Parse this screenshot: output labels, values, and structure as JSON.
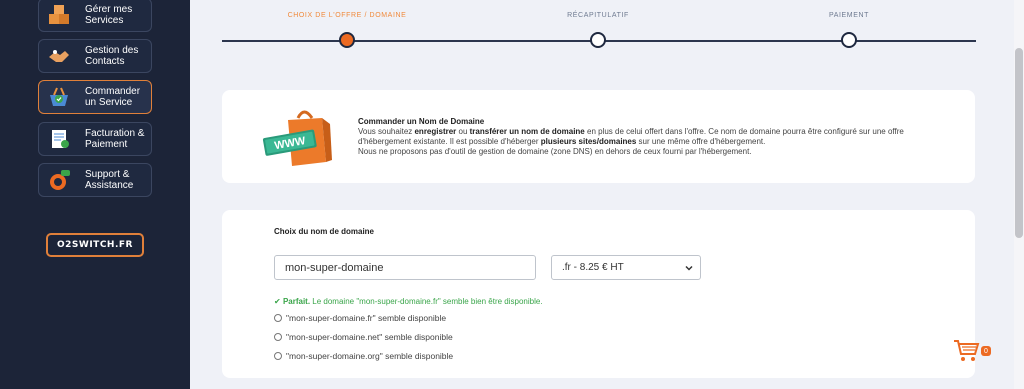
{
  "sidebar": {
    "items": [
      {
        "label": "Gérer mes Services",
        "icon": "boxes-icon",
        "active": false
      },
      {
        "label": "Gestion des Contacts",
        "icon": "handshake-icon",
        "active": false
      },
      {
        "label": "Commander un Service",
        "icon": "shopping-basket-icon",
        "active": true
      },
      {
        "label": "Facturation & Paiement",
        "icon": "invoice-icon",
        "active": false
      },
      {
        "label": "Support & Assistance",
        "icon": "lifebuoy-icon",
        "active": false
      }
    ],
    "domain_button": "O2SWITCH.FR"
  },
  "stepper": {
    "steps": [
      {
        "label": "CHOIX DE L'OFFRE / DOMAINE",
        "active": true
      },
      {
        "label": "RÉCAPITULATIF",
        "active": false
      },
      {
        "label": "PAIEMENT",
        "active": false
      }
    ]
  },
  "info": {
    "illustration_text": "WWW",
    "title": "Commander un Nom de Domaine",
    "p1_a": "Vous souhaitez ",
    "p1_b": "enregistrer",
    "p1_c": " ou ",
    "p1_d": "transférer un nom de domaine",
    "p1_e": " en plus de celui offert dans l'offre. Ce nom de domaine pourra être configuré sur une offre d'hébergement existante. Il est possible d'héberger ",
    "p1_f": "plusieurs sites/domaines",
    "p1_g": " sur une même offre d'hébergement.",
    "p2": "Nous ne proposons pas d'outil de gestion de domaine (zone DNS) en dehors de ceux fourni par l'hébergement."
  },
  "domain": {
    "title": "Choix du nom de domaine",
    "input_value": "mon-super-domaine",
    "selected_extension": ".fr - 8.25 € HT",
    "status_strong": "Parfait.",
    "status_text": " Le domaine \"mon-super-domaine.fr\" semble bien être disponible.",
    "options": [
      "\"mon-super-domaine.fr\" semble disponible",
      "\"mon-super-domaine.net\" semble disponible",
      "\"mon-super-domaine.org\" semble disponible"
    ]
  },
  "cart": {
    "count": "0"
  },
  "colors": {
    "accent": "#ec6a22",
    "sidebar": "#1c2438",
    "success": "#3aa54a"
  }
}
